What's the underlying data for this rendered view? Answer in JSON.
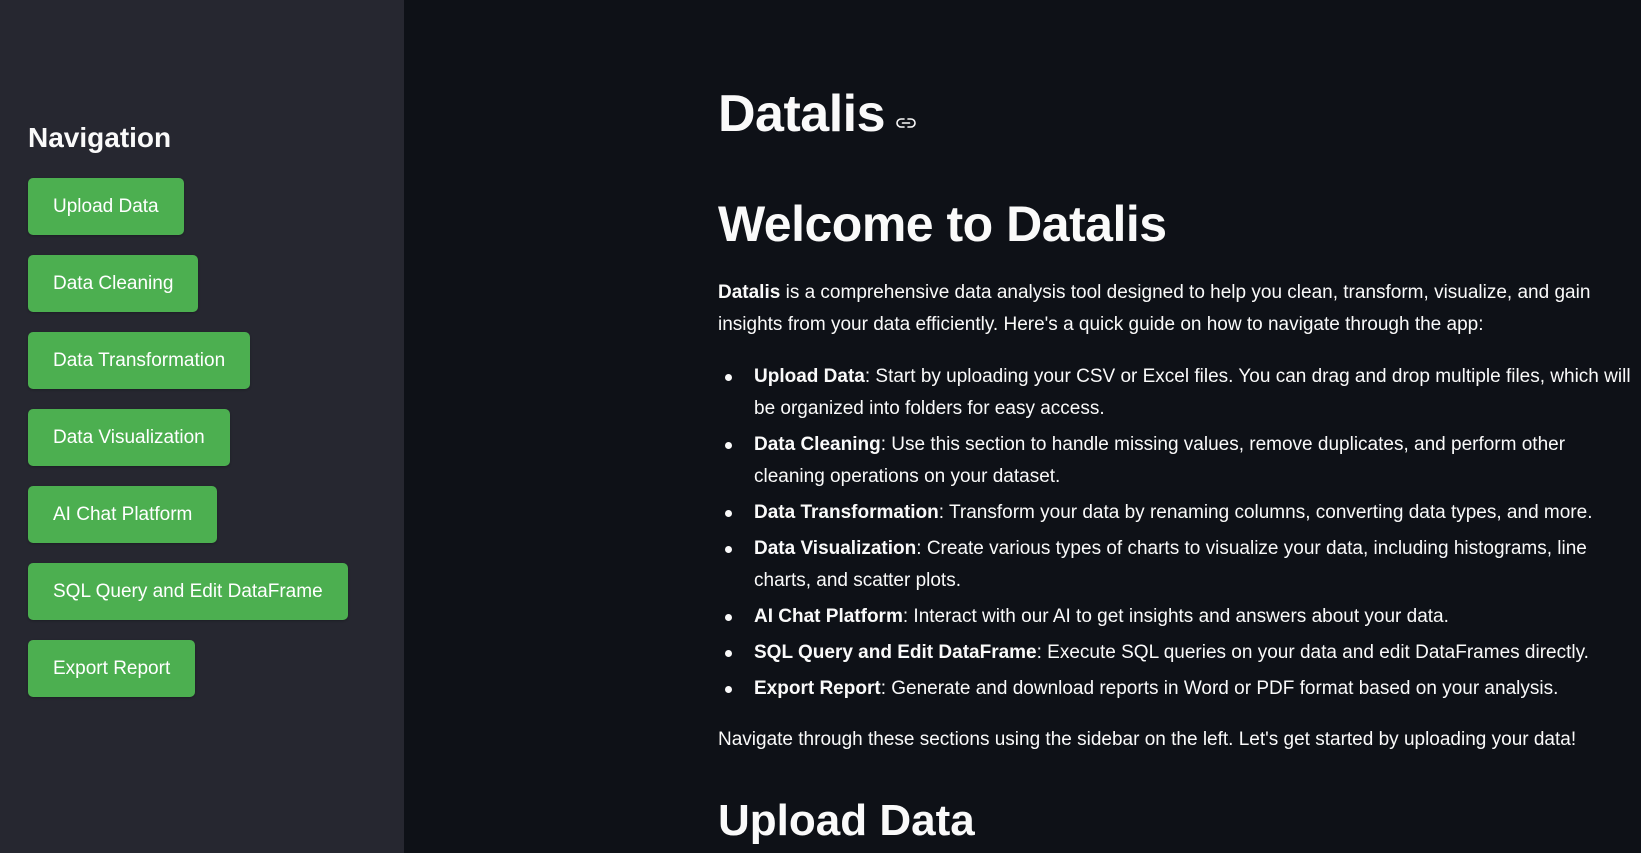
{
  "sidebar": {
    "title": "Navigation",
    "buttons": [
      {
        "label": "Upload Data"
      },
      {
        "label": "Data Cleaning"
      },
      {
        "label": "Data Transformation"
      },
      {
        "label": "Data Visualization"
      },
      {
        "label": "AI Chat Platform"
      },
      {
        "label": "SQL Query and Edit DataFrame"
      },
      {
        "label": "Export Report"
      }
    ]
  },
  "main": {
    "app_title": "Datalis",
    "welcome_title": "Welcome to Datalis",
    "intro": {
      "bold": "Datalis",
      "text": " is a comprehensive data analysis tool designed to help you clean, transform, visualize, and gain insights from your data efficiently. Here's a quick guide on how to navigate through the app:"
    },
    "guide": [
      {
        "title": "Upload Data",
        "text": ": Start by uploading your CSV or Excel files. You can drag and drop multiple files, which will be organized into folders for easy access."
      },
      {
        "title": "Data Cleaning",
        "text": ": Use this section to handle missing values, remove duplicates, and perform other cleaning operations on your dataset."
      },
      {
        "title": "Data Transformation",
        "text": ": Transform your data by renaming columns, converting data types, and more."
      },
      {
        "title": "Data Visualization",
        "text": ": Create various types of charts to visualize your data, including histograms, line charts, and scatter plots."
      },
      {
        "title": "AI Chat Platform",
        "text": ": Interact with our AI to get insights and answers about your data."
      },
      {
        "title": "SQL Query and Edit DataFrame",
        "text": ": Execute SQL queries on your data and edit DataFrames directly."
      },
      {
        "title": "Export Report",
        "text": ": Generate and download reports in Word or PDF format based on your analysis."
      }
    ],
    "outro": "Navigate through these sections using the sidebar on the left. Let's get started by uploading your data!",
    "section_title": "Upload Data"
  },
  "colors": {
    "sidebar_bg": "#262730",
    "main_bg": "#0e1117",
    "button_bg": "#4caf50",
    "text": "#fafafa"
  },
  "icons": {
    "title_anchor": "link-icon"
  }
}
